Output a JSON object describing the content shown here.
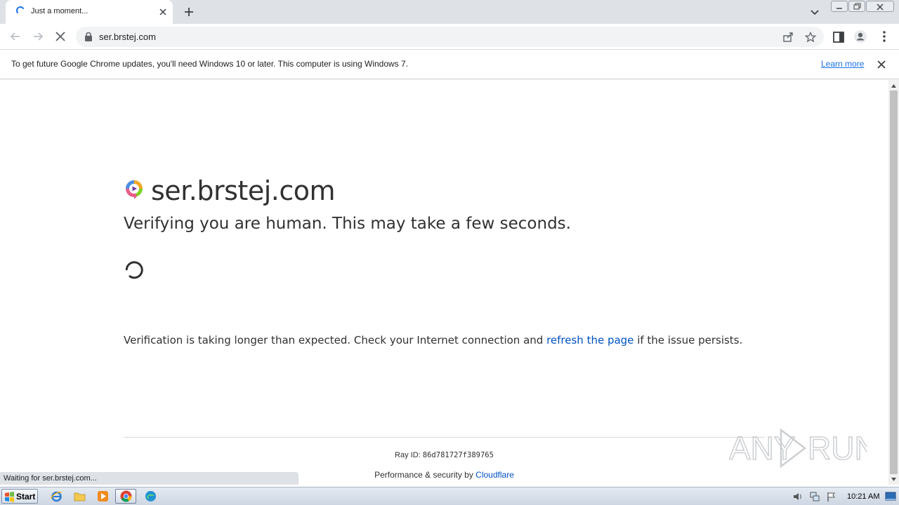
{
  "browser": {
    "tab": {
      "title": "Just a moment..."
    },
    "url": "ser.brstej.com"
  },
  "infobar": {
    "message": "To get future Google Chrome updates, you'll need Windows 10 or later. This computer is using Windows 7.",
    "link": "Learn more"
  },
  "page": {
    "heading": "ser.brstej.com",
    "title": "Verifying you are human. This may take a few seconds.",
    "longer_prefix": "Verification is taking longer than expected. Check your Internet connection and ",
    "longer_link": "refresh the page",
    "longer_suffix": " if the issue persists.",
    "ray_label": "Ray ID: ",
    "ray_id": "86d781727f389765",
    "perf_label": "Performance & security by ",
    "perf_link": "Cloudflare"
  },
  "status_bar": "Waiting for ser.brstej.com...",
  "watermark": "ANY RUN",
  "taskbar": {
    "start": "Start",
    "clock": "10:21 AM"
  },
  "colors": {
    "link_blue": "#0051c3",
    "chrome_link": "#1a73e8",
    "text": "#313131"
  }
}
